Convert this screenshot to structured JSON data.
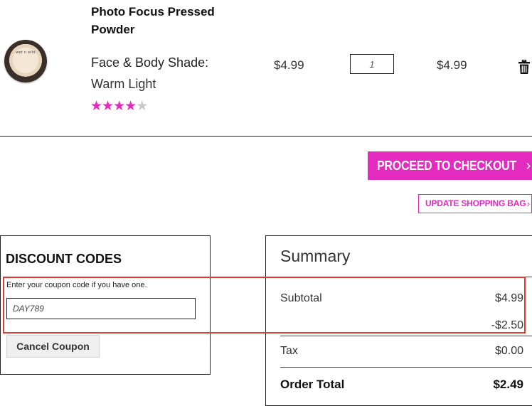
{
  "product": {
    "name": "Photo Focus Pressed Powder",
    "thumb_label": "wet n wild",
    "shade_label": "Face & Body Shade:",
    "shade_value": "Warm Light",
    "rating": 4,
    "rating_max": 5,
    "stars": [
      "★",
      "★",
      "★",
      "★",
      "★"
    ],
    "price": "$4.99",
    "quantity": "1",
    "line_total": "$4.99"
  },
  "actions": {
    "checkout_label": "PROCEED TO CHECKOUT",
    "update_label": "UPDATE SHOPPING BAG",
    "chevron": "›"
  },
  "discount": {
    "title": "DISCOUNT CODES",
    "hint": "Enter your coupon code if you have one.",
    "code_value": "DAY789",
    "cancel_label": "Cancel Coupon"
  },
  "summary": {
    "title": "Summary",
    "subtotal_label": "Subtotal",
    "subtotal_value": "$4.99",
    "discount_value": "-$2.50",
    "tax_label": "Tax",
    "tax_value": "$0.00",
    "total_label": "Order Total",
    "total_value": "$2.49"
  },
  "colors": {
    "accent": "#e42bbf",
    "highlight": "#e53935"
  },
  "icons": {
    "delete": "trash-icon",
    "product": "powder-compact-image"
  }
}
